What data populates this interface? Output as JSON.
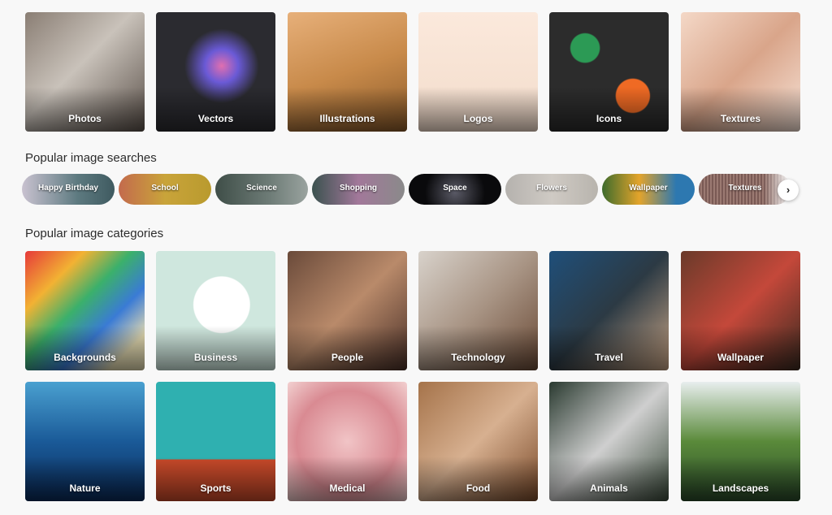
{
  "asset_types": [
    {
      "label": "Photos",
      "bg": "linear-gradient(135deg,#8a7e74,#c9c2ba 45%,#5b514a)"
    },
    {
      "label": "Vectors",
      "bg": "radial-gradient(circle at 55% 45%,#e06fb0 0,#6a5ad6 18%,#2b2b30 40%)"
    },
    {
      "label": "Illustrations",
      "bg": "linear-gradient(160deg,#e7b07a,#c88a4a 50%,#8a5a2a)"
    },
    {
      "label": "Logos",
      "bg": "linear-gradient(180deg,#fbe9dc,#f3dccb)"
    },
    {
      "label": "Icons",
      "bg": "radial-gradient(circle at 30% 30%,#2c9a55 0 12%,transparent 13%),radial-gradient(circle at 70% 70%,#ef6a24 0 14%,transparent 15%),#2c2c2c"
    },
    {
      "label": "Textures",
      "bg": "linear-gradient(135deg,#f4d8c7,#d9a58a 50%,#f7e2d6)"
    }
  ],
  "searches_heading": "Popular image searches",
  "searches": [
    {
      "label": "Happy Birthday",
      "bg": "linear-gradient(90deg,#c9c2d0,#5d7a80 60%,#3f5a60)"
    },
    {
      "label": "School",
      "bg": "linear-gradient(90deg,#c36a4d,#c9a43a 50%,#b99a2e)"
    },
    {
      "label": "Science",
      "bg": "linear-gradient(90deg,#3f4e48,#6f7d78 60%,#9aa39f)"
    },
    {
      "label": "Shopping",
      "bg": "linear-gradient(90deg,#3b524f,#a2789a 50%,#8a8a8a)"
    },
    {
      "label": "Space",
      "bg": "radial-gradient(circle at 50% 60%,#5a5a66,#0a0a0c 60%)"
    },
    {
      "label": "Flowers",
      "bg": "linear-gradient(90deg,#b5b2ae,#cfcac4 50%,#b8b4ad)"
    },
    {
      "label": "Wallpaper",
      "bg": "linear-gradient(90deg,#3d6b2c,#e3a42b 40%,#2d78b0 80%)"
    },
    {
      "label": "Textures",
      "bg": "repeating-linear-gradient(90deg,#7a5a55 0 2px,#9b7a72 2px 4px)"
    }
  ],
  "next_label": "›",
  "categories_heading": "Popular image categories",
  "categories": [
    {
      "label": "Backgrounds",
      "bg": "linear-gradient(135deg,#e63a3a,#f2b233 25%,#3bb06b 45%,#3a7bd5 65%,#e2d9b0 85%)"
    },
    {
      "label": "Business",
      "bg": "radial-gradient(circle at 55% 45%,#ffffff 0 30%,#cfe7de 31%)"
    },
    {
      "label": "People",
      "bg": "linear-gradient(135deg,#6a4a3a,#b98a6a 50%,#4a3028)"
    },
    {
      "label": "Technology",
      "bg": "linear-gradient(135deg,#d8d2cb,#a89484 50%,#6a4a36)"
    },
    {
      "label": "Travel",
      "bg": "linear-gradient(135deg,#1f4f7a,#2c3a44 50%,#c8a586)"
    },
    {
      "label": "Wallpaper",
      "bg": "linear-gradient(135deg,#6a3a2a,#c4483a 50%,#3a2a20)"
    },
    {
      "label": "Nature",
      "bg": "linear-gradient(180deg,#4aa0d0,#1a5a98 50%,#0a2a58)"
    },
    {
      "label": "Sports",
      "bg": "linear-gradient(180deg,#2fb0b0 0 65%,#c84a2a 65%)"
    },
    {
      "label": "Medical",
      "bg": "radial-gradient(circle at 50% 50%,#f1c4c6,#d98a92 60%,#f2d0d0)"
    },
    {
      "label": "Food",
      "bg": "linear-gradient(135deg,#a5734a,#d7b090 50%,#7a4a2a)"
    },
    {
      "label": "Animals",
      "bg": "linear-gradient(135deg,#2a3a30,#cfcfcf 50%,#3a4a3a)"
    },
    {
      "label": "Landscapes",
      "bg": "linear-gradient(180deg,#e8eeee,#5a8a3a 50%,#2a4a2a)"
    }
  ]
}
